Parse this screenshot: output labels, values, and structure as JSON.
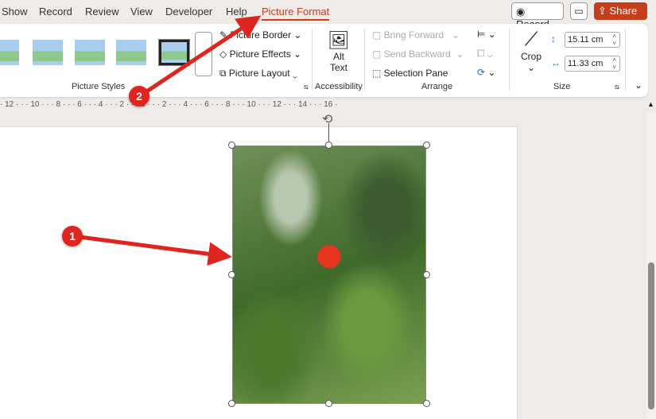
{
  "tabs": [
    "Show",
    "Record",
    "Review",
    "View",
    "Developer",
    "Help",
    "Picture Format"
  ],
  "active_tab": "Picture Format",
  "top_buttons": {
    "record": "Record",
    "share": "Share"
  },
  "accent": "#c43e1c",
  "ribbon": {
    "picture_styles": {
      "label": "Picture Styles",
      "border": "Picture Border",
      "effects": "Picture Effects",
      "layout": "Picture Layout"
    },
    "accessibility": {
      "label": "Accessibility",
      "alt_text": "Alt Text"
    },
    "arrange": {
      "label": "Arrange",
      "bring_forward": "Bring Forward",
      "send_backward": "Send Backward",
      "selection_pane": "Selection Pane"
    },
    "size": {
      "label": "Size",
      "crop": "Crop",
      "height": "15.11 cm",
      "width": "11.33 cm"
    }
  },
  "ruler": "· 12 · · · 10 · · · 8 · · · 6 · · · 4 · · · 2 · · · 0 · · · 2 · · · 4 · · · 6 · · · 8 · · · 10 · · · 12 · · · 14 · · · 16 ·",
  "annotations": [
    "1",
    "2"
  ]
}
